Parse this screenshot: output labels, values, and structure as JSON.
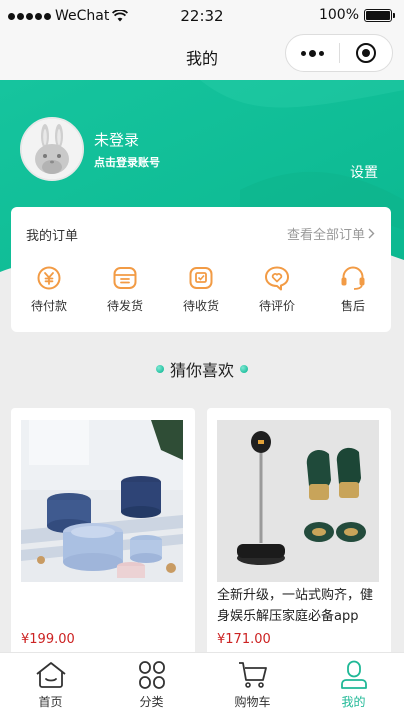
{
  "status_bar": {
    "carrier": "WeChat",
    "time": "22:32",
    "battery_text": "100%",
    "battery_level": 1.0
  },
  "nav": {
    "title": "我的"
  },
  "profile": {
    "title": "未登录",
    "subtitle": "点击登录账号",
    "settings_label": "设置"
  },
  "orders": {
    "title": "我的订单",
    "view_all": "查看全部订单",
    "items": [
      {
        "label": "待付款",
        "icon": "yuan-coin-icon"
      },
      {
        "label": "待发货",
        "icon": "package-icon"
      },
      {
        "label": "待收货",
        "icon": "receive-box-icon"
      },
      {
        "label": "待评价",
        "icon": "heart-comment-icon"
      },
      {
        "label": "售后",
        "icon": "headset-icon"
      }
    ]
  },
  "recommend": {
    "title": "猜你喜欢"
  },
  "products": [
    {
      "title": "",
      "price": "¥199.00",
      "image": "cookware-photo"
    },
    {
      "title": "全新升级，一站式购齐，健身娱乐解压家庭必备app",
      "price": "¥171.00",
      "image": "boxing-set-photo"
    }
  ],
  "tabs": [
    {
      "label": "首页",
      "icon": "home-icon",
      "active": false
    },
    {
      "label": "分类",
      "icon": "category-icon",
      "active": false
    },
    {
      "label": "购物车",
      "icon": "cart-icon",
      "active": false
    },
    {
      "label": "我的",
      "icon": "user-icon",
      "active": true
    }
  ],
  "colors": {
    "accent": "#1fb896",
    "header": "#1cc39a",
    "order_icon": "#f29b45",
    "price": "#cc2222"
  }
}
